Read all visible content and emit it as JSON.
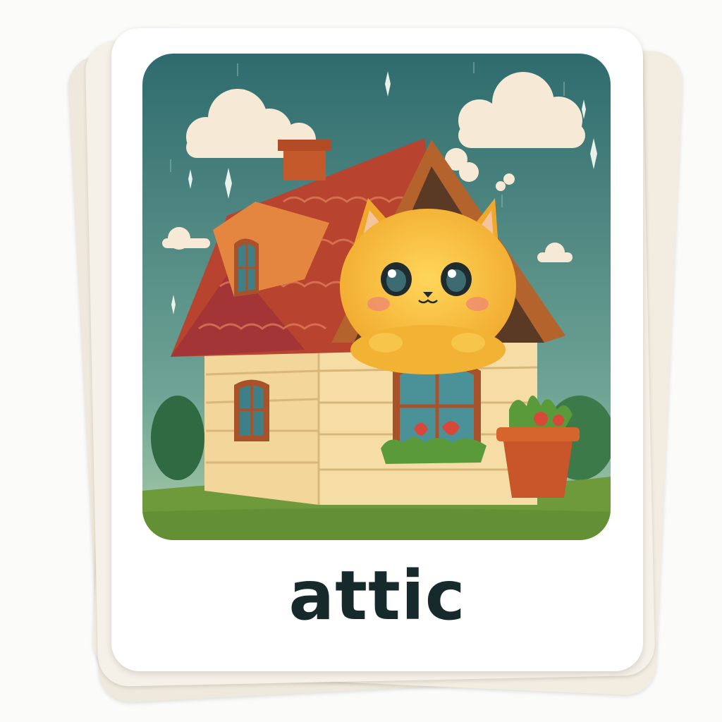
{
  "card": {
    "word": "attic"
  },
  "colors": {
    "sky_top": "#2f6b6e",
    "sky_bottom": "#9cc3a9",
    "roof": "#b8432e",
    "walls": "#f2d69a",
    "cat": "#f6c13f",
    "grass": "#6f9a3c",
    "text": "#172a2b"
  },
  "illustration": {
    "subject": "cat-in-attic"
  }
}
